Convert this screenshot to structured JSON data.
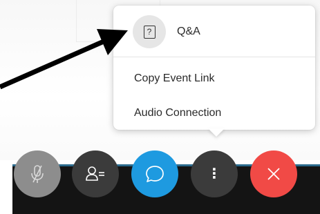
{
  "menu": {
    "items": [
      {
        "label": "Q&A",
        "icon": "qa-icon",
        "icon_glyph": "?"
      },
      {
        "label": "Copy Event Link"
      },
      {
        "label": "Audio Connection"
      }
    ]
  },
  "toolbar": {
    "buttons": [
      {
        "name": "mute-button",
        "icon": "mic-muted-icon",
        "color": "#8d8d8d"
      },
      {
        "name": "participants-button",
        "icon": "participants-icon",
        "color": "#3b3b3b"
      },
      {
        "name": "chat-button",
        "icon": "chat-icon",
        "color": "#1e9ae0"
      },
      {
        "name": "more-options-button",
        "icon": "more-icon",
        "glyph": "⋮",
        "color": "#3b3b3b"
      },
      {
        "name": "leave-button",
        "icon": "close-icon",
        "color": "#f14a46"
      }
    ]
  },
  "annotation": {
    "arrow": "black-arrow-pointing-to-qa",
    "color": "#000000"
  }
}
